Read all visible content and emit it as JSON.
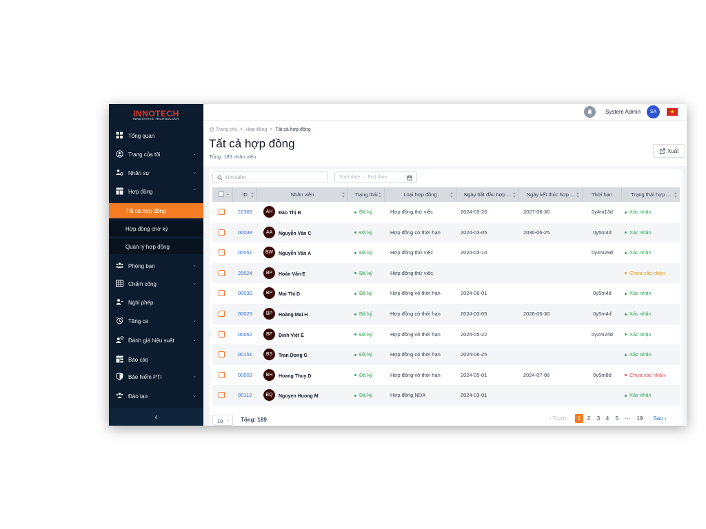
{
  "brand": {
    "name": "INNOTECH",
    "tagline": "INNOVATIVE TECHNOLOGY"
  },
  "sidebar": {
    "items": [
      {
        "label": "Tổng quan",
        "icon": "dashboard-icon",
        "chevron": ""
      },
      {
        "label": "Trang của tôi",
        "icon": "user-circle-icon",
        "chevron": "down"
      },
      {
        "label": "Nhân sự",
        "icon": "people-gear-icon",
        "chevron": "down"
      },
      {
        "label": "Hợp đồng",
        "icon": "layout-icon",
        "chevron": "up"
      },
      {
        "label": "Phòng ban",
        "icon": "team-icon",
        "chevron": "down"
      },
      {
        "label": "Chấm công",
        "icon": "calendar-grid-icon",
        "chevron": "down"
      },
      {
        "label": "Nghỉ phép",
        "icon": "user-leave-icon",
        "chevron": ""
      },
      {
        "label": "Tăng ca",
        "icon": "alarm-clock-icon",
        "chevron": "down"
      },
      {
        "label": "Đánh giá hiệu suất",
        "icon": "performance-icon",
        "chevron": "down"
      },
      {
        "label": "Báo cáo",
        "icon": "report-icon",
        "chevron": ""
      },
      {
        "label": "Bảo hiểm PTI",
        "icon": "shield-icon",
        "chevron": "down"
      },
      {
        "label": "Đào tạo",
        "icon": "training-icon",
        "chevron": "down"
      }
    ],
    "subitems": [
      {
        "label": "Tất cả hợp đồng",
        "active": true
      },
      {
        "label": "Hợp đồng chờ ký",
        "active": false
      },
      {
        "label": "Quản lý hợp đồng",
        "active": false
      }
    ],
    "collapse_label": "‹"
  },
  "header": {
    "user_name": "System Admin",
    "avatar_initials": "SA",
    "flag_star": "★"
  },
  "breadcrumb": [
    "Trang chủ",
    "Hợp đồng",
    "Tất cả hợp đồng"
  ],
  "breadcrumb_sep": ">",
  "page": {
    "title": "Tất cả hợp đồng",
    "total_text": "Tổng: 189 nhân viên",
    "export_label": "Xuất"
  },
  "filters": {
    "search_placeholder": "Tìm kiếm",
    "date_placeholder": "Start date → End date"
  },
  "table": {
    "columns": [
      "",
      "ID",
      "Nhân viên",
      "Trạng thái",
      "Loại hợp đồng",
      "Ngày bắt đầu hợp ...",
      "Ngày kết thúc hợp ...",
      "Thời hạn",
      "Trạng thái hợp ..."
    ],
    "rows": [
      {
        "id": "22369",
        "initials": "AH",
        "name": "Đào Thị B",
        "status": "Đã ký",
        "type": "Hợp đồng thử việc",
        "start": "2024-03-26",
        "end": "2027-06-30",
        "duration": "0y4m13d",
        "confirm": "Xác nhận",
        "confirm_color": "#2aa650"
      },
      {
        "id": "00038",
        "initials": "AA",
        "name": "Nguyễn Văn C",
        "status": "Đã ký",
        "type": "Hợp đồng có thời hạn",
        "start": "2024-03-05",
        "end": "2030-06-25",
        "duration": "0y5m4d",
        "confirm": "Xác nhận",
        "confirm_color": "#2aa650"
      },
      {
        "id": "00051",
        "initials": "BW",
        "name": "Nguyễn Văn A",
        "status": "Đã ký",
        "type": "Hợp đồng thử việc",
        "start": "2024-03-10",
        "end": "",
        "duration": "0y4m29d",
        "confirm": "Xác nhận",
        "confirm_color": "#2aa650"
      },
      {
        "id": "29024",
        "initials": "BP",
        "name": "Hoàn Văn E",
        "status": "Đã ký",
        "type": "Hợp đồng thử việc",
        "start": "",
        "end": "",
        "duration": "",
        "confirm": "Chưa xác nhận",
        "confirm_color": "#e39a1c"
      },
      {
        "id": "00030",
        "initials": "BP",
        "name": "Mai Thị D",
        "status": "Đã ký",
        "type": "Hợp đồng vô thời hạn",
        "start": "2024-06-01",
        "end": "",
        "duration": "0y5m4d",
        "confirm": "Xác nhận",
        "confirm_color": "#2aa650"
      },
      {
        "id": "00029",
        "initials": "BP",
        "name": "Hoàng Mai H",
        "status": "Đã ký",
        "type": "Hợp đồng có thời hạn",
        "start": "2024-03-05",
        "end": "2026-06-30",
        "duration": "0y5m4d",
        "confirm": "Xác nhận",
        "confirm_color": "#2aa650"
      },
      {
        "id": "00062",
        "initials": "BF",
        "name": "Đinh Việt E",
        "status": "Đã ký",
        "type": "Hợp đồng vô thời hạn",
        "start": "2024-05-22",
        "end": "",
        "duration": "0y2m24d",
        "confirm": "Xác nhận",
        "confirm_color": "#2aa650"
      },
      {
        "id": "00151",
        "initials": "BS",
        "name": "Tran Dong G",
        "status": "Đã ký",
        "type": "Hợp đồng có thời hạn",
        "start": "2024-06-25",
        "end": "",
        "duration": "",
        "confirm": "Xác nhận",
        "confirm_color": "#2aa650"
      },
      {
        "id": "00003",
        "initials": "BH",
        "name": "Hoang Thuy D",
        "status": "Đã ký",
        "type": "Hợp đồng vô thời hạn",
        "start": "2024-05-01",
        "end": "2024-07-06",
        "duration": "0y5m8d",
        "confirm": "Chưa xác nhận",
        "confirm_color": "#e0454b"
      },
      {
        "id": "00112",
        "initials": "BQ",
        "name": "Nguyen Huong M",
        "status": "Đã ký",
        "type": "Hợp đồng NDA",
        "start": "2024-03-01",
        "end": "",
        "duration": "",
        "confirm": "Xác nhận",
        "confirm_color": "#2aa650"
      }
    ]
  },
  "footer": {
    "page_size": "10",
    "total_label": "Tổng: 189",
    "prev_label": "‹ Trước",
    "pages": [
      "1",
      "2",
      "3",
      "4",
      "5",
      "•••",
      "19"
    ],
    "current_page": "1",
    "next_label": "Sau ›"
  },
  "colors": {
    "accent": "#f57c23",
    "sidebar_bg": "#0c1b2e",
    "link": "#2f6fde",
    "avatar_bg": "#2f55d4"
  }
}
